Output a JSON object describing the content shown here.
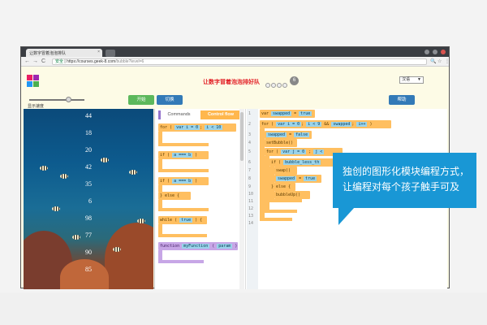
{
  "browser": {
    "tab_title": "让数字冒着泡泡排队",
    "tab_close": "×",
    "secure_label": "安全",
    "url_host": "https://courses.geek-8.com",
    "url_path": "/bubble?level=6",
    "back": "←",
    "forward": "→",
    "reload": "C",
    "home": "⌂",
    "zoom_icon": "🔍",
    "star_icon": "☆",
    "menu_icon": "⋮"
  },
  "header": {
    "title": "让数字冒着泡泡排好队",
    "level": "6",
    "language_selected": "汉语",
    "language_arrow": "▼"
  },
  "controls": {
    "speed_label": "显示速度",
    "start_label": "开始",
    "switch_label": "切换",
    "help_label": "帮助",
    "speed_level": 0.8
  },
  "aquarium": {
    "numbers": [
      "44",
      "18",
      "20",
      "42",
      "35",
      "6",
      "98",
      "77",
      "90",
      "85"
    ]
  },
  "toolbox": {
    "tab_commands": "Commands",
    "tab_control": "Control flow",
    "for_kw": "for",
    "for_var": "var",
    "for_i": "i",
    "for_eq": "=",
    "for_zero": "0",
    "for_semi": ";",
    "for_cond_i": "i",
    "for_lt": "<",
    "for_ten": "10",
    "if_kw": "if",
    "if_a": "a",
    "if_eq": "===",
    "if_b": "b",
    "if_kw2": "if",
    "if_a2": "a",
    "if_eq2": "===",
    "if_b2": "b",
    "else_kw": "else",
    "else_brace": "{",
    "while_kw": "while",
    "while_true": "true",
    "function_kw": "function",
    "function_name": "myFunction",
    "function_param": "param"
  },
  "code": {
    "line_numbers": [
      "1",
      "2",
      "3",
      "4",
      "5",
      "6",
      "7",
      "8",
      "9",
      "10",
      "11",
      "12",
      "13",
      "14"
    ],
    "l1_var": "var",
    "l1_name": "swapped",
    "l1_eq": "=",
    "l1_val": "true",
    "l2_for": "for",
    "l2_var": "var",
    "l2_i": "i",
    "l2_eq": "=",
    "l2_zero": "0",
    "l2_semi": ";",
    "l2_i2": "i",
    "l2_and": "&&",
    "l2_swapped": "swapped",
    "l2_semi2": ";",
    "l2_inc": "i++",
    "l3_swapped": "swapped",
    "l3_eq": "=",
    "l3_false": "false",
    "l4_call": "setBubble()",
    "l5_for": "for",
    "l5_var": "var",
    "l5_j": "j",
    "l5_eq": "=",
    "l5_zero": "0",
    "l6_if": "if",
    "l6_cond": "bubble_less_th",
    "l7_call": "swap()",
    "l8_swapped": "swapped",
    "l8_eq": "=",
    "l8_true": "true",
    "l9_else": "else",
    "l9_brace": "{",
    "l10_call": "bubbleUp()"
  },
  "callout": {
    "line1": "独创的图形化模块编程方式，",
    "line2": "让编程对每个孩子触手可及"
  },
  "colors": {
    "title_red": "#e21d24",
    "start_green": "#5cb85c",
    "primary_blue": "#337ab7",
    "block_orange": "#ffbf60",
    "block_purple": "#c7a6e6",
    "slot_blue": "#9ad3ea",
    "callout_blue": "#1997d5"
  }
}
